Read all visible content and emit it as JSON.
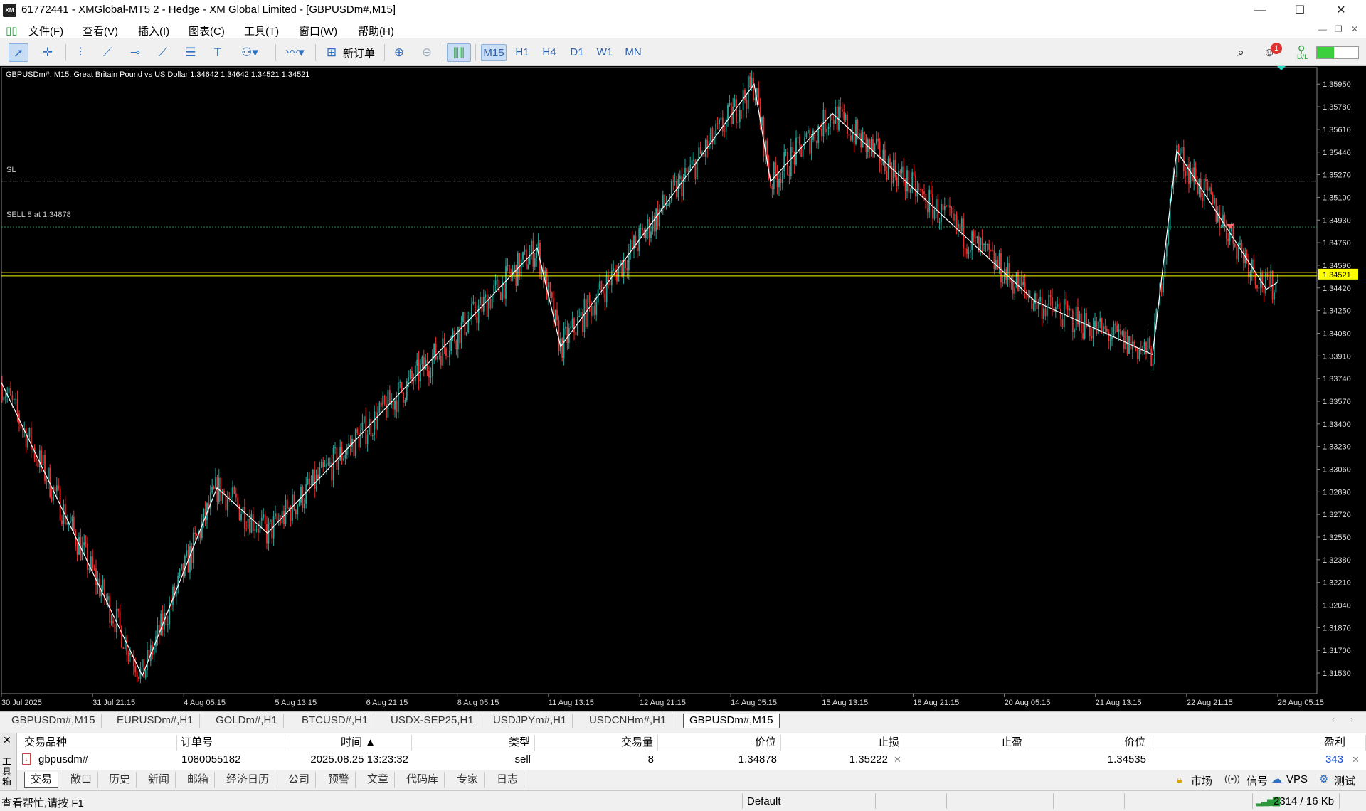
{
  "window": {
    "title": "61772441 - XMGlobal-MT5 2 - Hedge - XM Global Limited - [GBPUSDm#,M15]",
    "logo": "XM",
    "minimize": "—",
    "maximize": "☐",
    "close": "✕"
  },
  "menu": {
    "items": [
      "文件(F)",
      "查看(V)",
      "插入(I)",
      "图表(C)",
      "工具(T)",
      "窗口(W)",
      "帮助(H)"
    ],
    "mdi": [
      "—",
      "❐",
      "✕"
    ]
  },
  "toolbar": {
    "new_order": "新订单",
    "timeframes": [
      "M15",
      "H1",
      "H4",
      "D1",
      "W1",
      "MN"
    ],
    "active_timeframe": "M15",
    "notification_count": "1",
    "lvl": "LVL"
  },
  "chart": {
    "header": "GBPUSDm#, M15:  Great Britain Pound vs US Dollar  1.34642 1.34642 1.34521 1.34521",
    "sl_label": "SL",
    "sell_label": "SELL 8 at 1.34878",
    "current_price": "1.34521",
    "colors": {
      "background": "#000000",
      "bull": "#26a69a",
      "bear": "#ef3030",
      "zigzag": "#ffffff",
      "price_line": "#ffff00",
      "sl_line": "#cccccc",
      "order_line": "#2e8b57"
    },
    "yaxis_labels": [
      "1.35950",
      "1.35780",
      "1.35610",
      "1.35440",
      "1.35270",
      "1.35100",
      "1.34930",
      "1.34760",
      "1.34590",
      "1.34420",
      "1.34250",
      "1.34080",
      "1.33910",
      "1.33740",
      "1.33570",
      "1.33400",
      "1.33230",
      "1.33060",
      "1.32890",
      "1.32720",
      "1.32550",
      "1.32380",
      "1.32210",
      "1.32040",
      "1.31870",
      "1.31700",
      "1.31530"
    ],
    "xaxis_labels": [
      "30 Jul 2025",
      "31 Jul 21:15",
      "4 Aug 05:15",
      "5 Aug 13:15",
      "6 Aug 21:15",
      "8 Aug 05:15",
      "11 Aug 13:15",
      "12 Aug 21:15",
      "14 Aug 05:15",
      "15 Aug 13:15",
      "18 Aug 21:15",
      "20 Aug 05:15",
      "21 Aug 13:15",
      "22 Aug 21:15",
      "26 Aug 05:15"
    ],
    "sl_price": 1.35222,
    "order_price": 1.34878,
    "price": 1.34521,
    "ylim": [
      1.3145,
      1.3601
    ]
  },
  "chart_tabs": [
    "GBPUSDm#,M15",
    "EURUSDm#,H1",
    "GOLDm#,H1",
    "BTCUSD#,H1",
    "USDX-SEP25,H1",
    "USDJPYm#,H1",
    "USDCNHm#,H1",
    "GBPUSDm#,M15"
  ],
  "toolbox": {
    "side_label": "工具箱",
    "headers": [
      "交易品种",
      "订单号",
      "时间",
      "类型",
      "交易量",
      "价位",
      "止损",
      "止盈",
      "价位",
      "盈利"
    ],
    "row": {
      "symbol": "gbpusdm#",
      "order": "1080055182",
      "time": "2025.08.25 13:23:32",
      "type": "sell",
      "volume": "8",
      "open_price": "1.34878",
      "sl": "1.35222",
      "tp": "",
      "price": "1.34535",
      "profit": "343"
    }
  },
  "bottom_tabs": [
    "交易",
    "敞口",
    "历史",
    "新闻",
    "邮箱",
    "经济日历",
    "公司",
    "预警",
    "文章",
    "代码库",
    "专家",
    "日志"
  ],
  "bottom_right": [
    "市场",
    "信号",
    "VPS",
    "测试"
  ],
  "status": {
    "help": "查看帮忙,请按 F1",
    "profile": "Default",
    "traffic": "2314 / 16 Kb"
  }
}
